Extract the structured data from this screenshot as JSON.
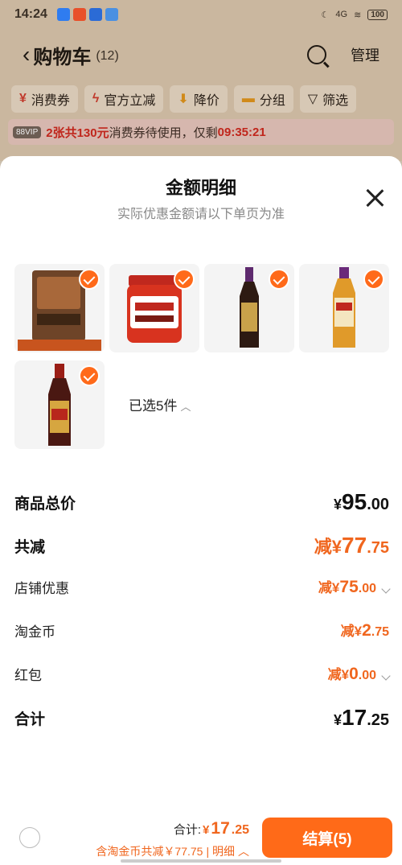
{
  "status": {
    "time": "14:24",
    "signal": "4G",
    "battery": "100"
  },
  "navbar": {
    "title": "购物车",
    "count": "(12)",
    "manage_label": "管理"
  },
  "filters": [
    {
      "icon": "coupon-icon",
      "label": "消费券"
    },
    {
      "icon": "lightning-icon",
      "label": "官方立减"
    },
    {
      "icon": "down-arrow-icon",
      "label": "降价"
    },
    {
      "icon": "folder-icon",
      "label": "分组"
    },
    {
      "icon": "filter-icon",
      "label": "筛选"
    }
  ],
  "coupon_bar": {
    "vip": "88VIP",
    "highlight": "2张共130元",
    "text": "消费券待使用，仅剩",
    "countdown": "09:35:21"
  },
  "sheet": {
    "title": "金额明细",
    "subtitle": "实际优惠金额请以下单页为准",
    "selected": "已选5件",
    "products": [
      {
        "name": "广式牛腩煲调味料",
        "caption": "广式牛腩煲调味料100g",
        "color": "#7a4a2a"
      },
      {
        "name": "海鲜酱",
        "caption": "",
        "color": "#c0281e"
      },
      {
        "name": "酱油",
        "caption": "",
        "color": "#3b2418"
      },
      {
        "name": "金标料酒",
        "caption": "",
        "color": "#d88a1c"
      },
      {
        "name": "酱油",
        "caption": "",
        "color": "#5a1e16"
      }
    ]
  },
  "breakdown": {
    "total_label": "商品总价",
    "total_currency": "¥",
    "total_int": "95",
    "total_dec": ".00",
    "reduce_label": "共减",
    "reduce_prefix": "减¥",
    "reduce_int": "77",
    "reduce_dec": ".75",
    "shop_label": "店铺优惠",
    "shop_prefix": "减¥",
    "shop_int": "75",
    "shop_dec": ".00",
    "coin_label": "淘金币",
    "coin_prefix": "减¥",
    "coin_int": "2",
    "coin_dec": ".75",
    "redpacket_label": "红包",
    "redpacket_prefix": "减¥",
    "redpacket_int": "0",
    "redpacket_dec": ".00",
    "sum_label": "合计",
    "sum_currency": "¥",
    "sum_int": "17",
    "sum_dec": ".25"
  },
  "bottom": {
    "total_label": "合计:",
    "total_currency": "¥",
    "total_int": "17",
    "total_dec": ".25",
    "discount_text": "含淘金币共减￥77.75",
    "detail_label": "| 明细",
    "checkout_label": "结算(5)"
  },
  "colors": {
    "accent": "#ff6a18",
    "price_orange": "#f0661e"
  }
}
